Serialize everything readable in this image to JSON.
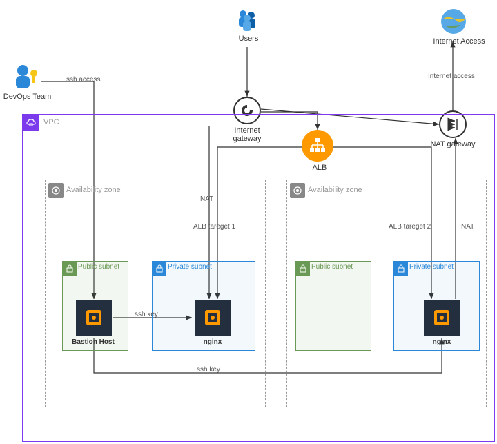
{
  "nodes": {
    "users": "Users",
    "devops_team": "DevOps Team",
    "internet_access": "Internet Access",
    "internet_gateway": "Internet\ngateway",
    "alb": "ALB",
    "nat_gateway": "NAT gateway",
    "bastion_host": "Bastion Host",
    "nginx_left": "nginx",
    "nginx_right": "nginx"
  },
  "containers": {
    "vpc": "VPC",
    "az_left": "Availability zone",
    "az_right": "Availability zone",
    "public_subnet_left": "Public subnet",
    "private_subnet_left": "Private subnet",
    "public_subnet_right": "Public subnet",
    "private_subnet_right": "Private subnet"
  },
  "edges": {
    "ssh_access": "ssh access",
    "internet_access": "Internet access",
    "nat_left": "NAT",
    "nat_right": "NAT",
    "alb_target_1": "ALB tareget 1",
    "alb_target_2": "ALB tareget 2",
    "ssh_key_1": "ssh key",
    "ssh_key_2": "ssh key"
  }
}
